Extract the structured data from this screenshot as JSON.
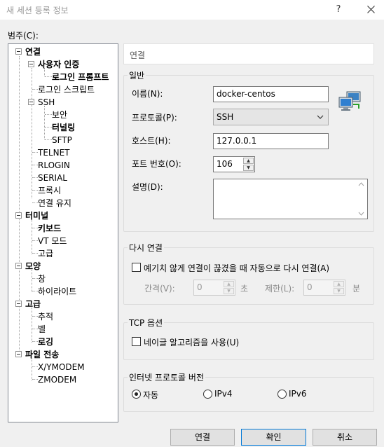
{
  "window": {
    "title": "새 세션 등록 정보",
    "help_label": "?"
  },
  "category_label": "범주(C):",
  "tree": {
    "items": [
      {
        "label": "연결",
        "bold": true
      },
      {
        "label": "사용자 인증",
        "bold": true
      },
      {
        "label": "로그인 프롬프트",
        "bold": true
      },
      {
        "label": "로그인 스크립트",
        "bold": false
      },
      {
        "label": "SSH",
        "bold": false
      },
      {
        "label": "보안",
        "bold": false
      },
      {
        "label": "터널링",
        "bold": true
      },
      {
        "label": "SFTP",
        "bold": false
      },
      {
        "label": "TELNET",
        "bold": false
      },
      {
        "label": "RLOGIN",
        "bold": false
      },
      {
        "label": "SERIAL",
        "bold": false
      },
      {
        "label": "프록시",
        "bold": false
      },
      {
        "label": "연결 유지",
        "bold": false
      },
      {
        "label": "터미널",
        "bold": true
      },
      {
        "label": "키보드",
        "bold": true
      },
      {
        "label": "VT 모드",
        "bold": false
      },
      {
        "label": "고급",
        "bold": false
      },
      {
        "label": "모양",
        "bold": true
      },
      {
        "label": "창",
        "bold": false
      },
      {
        "label": "하이라이트",
        "bold": false
      },
      {
        "label": "고급",
        "bold": true
      },
      {
        "label": "추적",
        "bold": false
      },
      {
        "label": "벨",
        "bold": false
      },
      {
        "label": "로깅",
        "bold": true
      },
      {
        "label": "파일 전송",
        "bold": true
      },
      {
        "label": "X/YMODEM",
        "bold": false
      },
      {
        "label": "ZMODEM",
        "bold": false
      }
    ]
  },
  "panel_header": "연결",
  "general": {
    "legend": "일반",
    "name_label": "이름(N):",
    "name_value": "docker-centos",
    "protocol_label": "프로토콜(P):",
    "protocol_value": "SSH",
    "host_label": "호스트(H):",
    "host_value": "127.0.0.1",
    "port_label": "포트 번호(O):",
    "port_value": "106",
    "desc_label": "설명(D):",
    "desc_value": ""
  },
  "reconnect": {
    "legend": "다시 연결",
    "auto_label": "예기치 않게 연결이 끊겼을 때 자동으로 다시 연결(A)",
    "interval_label": "간격(V):",
    "interval_value": "0",
    "interval_unit": "초",
    "limit_label": "제한(L):",
    "limit_value": "0",
    "limit_unit": "분"
  },
  "tcp": {
    "legend": "TCP 옵션",
    "nagle_label": "네이글 알고리즘을 사용(U)"
  },
  "ipver": {
    "legend": "인터넷 프로토콜 버전",
    "opt_auto": "자동",
    "opt_ipv4": "IPv4",
    "opt_ipv6": "IPv6",
    "selected": "자동"
  },
  "buttons": {
    "connect": "연결",
    "ok": "확인",
    "cancel": "취소"
  },
  "colors": {
    "accent": "#0078d7",
    "tree_border": "#828790"
  }
}
